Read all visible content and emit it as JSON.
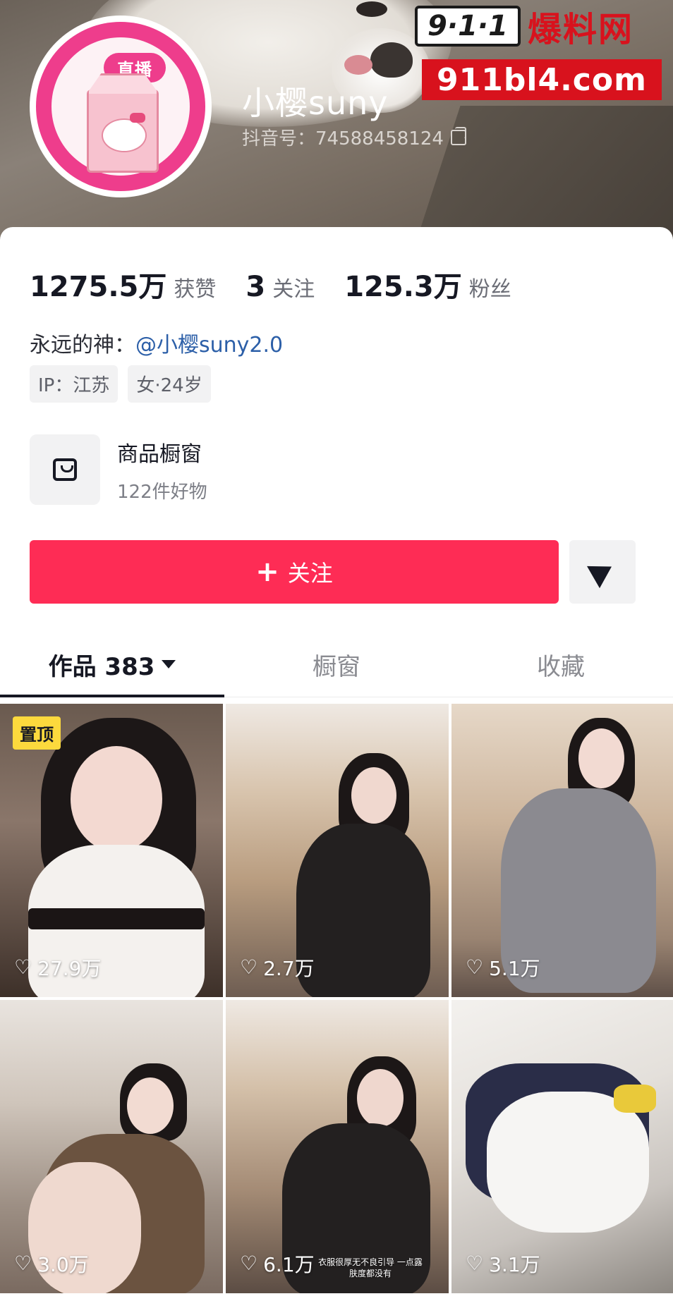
{
  "watermark": {
    "badge": "9·1·1",
    "cn_text": "爆料网",
    "url": "911bl4.com"
  },
  "profile": {
    "live_badge": "直播",
    "name": "小樱suny",
    "douyin_id": "抖音号：74588458124"
  },
  "stats": [
    {
      "value": "1275.5万",
      "label": "获赞"
    },
    {
      "value": "3",
      "label": "关注"
    },
    {
      "value": "125.3万",
      "label": "粉丝"
    }
  ],
  "bio": {
    "prefix": "永远的神：",
    "mention": "@小樱suny2.0"
  },
  "tags": [
    "IP：江苏",
    "女·24岁"
  ],
  "shop": {
    "title": "商品橱窗",
    "subtitle": "122件好物"
  },
  "actions": {
    "follow_label": "关注",
    "follow_plus": "+"
  },
  "tabs": [
    {
      "label": "作品 383"
    },
    {
      "label": "橱窗"
    },
    {
      "label": "收藏"
    }
  ],
  "videos": [
    {
      "likes": "27.9万",
      "pin": "置顶"
    },
    {
      "likes": "2.7万"
    },
    {
      "likes": "5.1万"
    },
    {
      "likes": "3.0万"
    },
    {
      "likes": "6.1万",
      "caption": "衣服很厚无不良引导 一点露肤度都没有"
    },
    {
      "likes": "3.1万"
    }
  ],
  "colors": {
    "accent": "#fe2c55",
    "avatar_pink": "#ee3d8c",
    "mention_blue": "#2c5fa8",
    "watermark_red": "#d8121d",
    "pin_yellow": "#fcd93d"
  },
  "icons": {
    "copy": "copy-icon",
    "bag": "shopping-bag-icon",
    "share": "send-icon",
    "caret": "caret-down-icon",
    "heart": "heart-outline-icon"
  }
}
